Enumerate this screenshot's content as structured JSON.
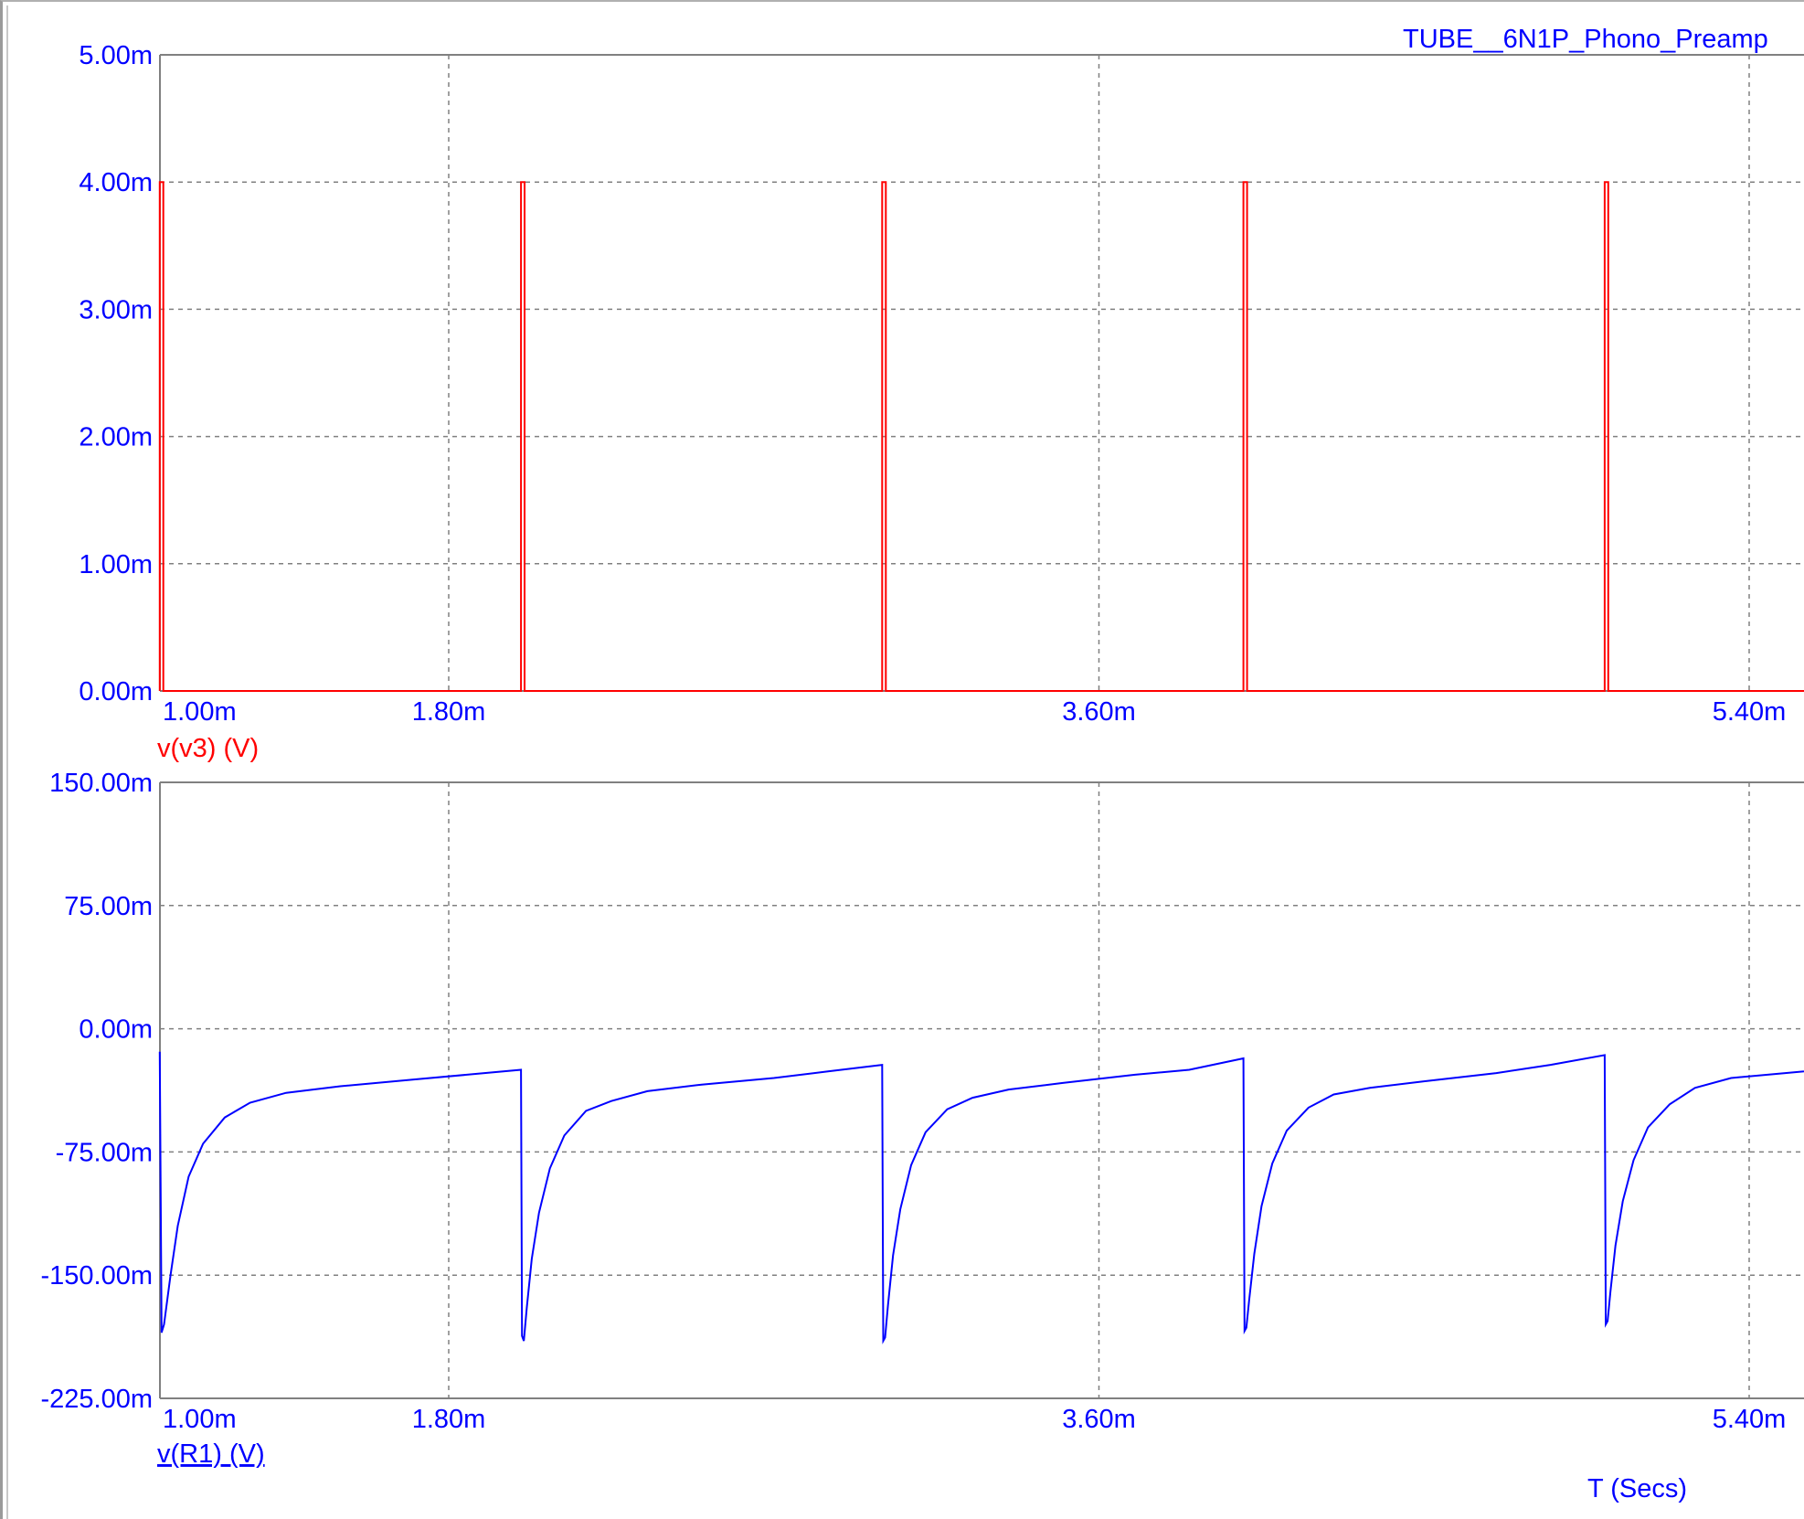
{
  "title": "TUBE__6N1P_Phono_Preamp",
  "x_axis_label": "T (Secs)",
  "colors": {
    "top_trace": "#ff0000",
    "bottom_trace": "#0000ff",
    "text_blue": "#0000ff",
    "grid": "#808080",
    "axis": "#808080"
  },
  "chart_data": [
    {
      "type": "line",
      "name": "top-plot",
      "title": "TUBE__6N1P_Phono_Preamp",
      "trace_label": "v(v3) (V)",
      "xlim": [
        1.0,
        6.0
      ],
      "ylim": [
        0.0,
        5.0
      ],
      "x_ticks": [
        {
          "v": 1.0,
          "label": "1.00m"
        },
        {
          "v": 1.8,
          "label": "1.80m"
        },
        {
          "v": 3.6,
          "label": "3.60m"
        },
        {
          "v": 5.4,
          "label": "5.40m"
        }
      ],
      "y_ticks": [
        {
          "v": 0,
          "label": "0.00m"
        },
        {
          "v": 1,
          "label": "1.00m"
        },
        {
          "v": 2,
          "label": "2.00m"
        },
        {
          "v": 3,
          "label": "3.00m"
        },
        {
          "v": 4,
          "label": "4.00m"
        },
        {
          "v": 5,
          "label": "5.00m"
        }
      ],
      "x_grid": [
        1.8,
        3.6,
        5.4
      ],
      "y_grid": [
        1,
        2,
        3,
        4
      ],
      "series": [
        {
          "x": [
            1.0,
            1.0,
            1.01,
            1.01,
            2.0,
            2.0,
            2.01,
            2.01,
            3.0,
            3.0,
            3.01,
            3.01,
            4.0,
            4.0,
            4.01,
            4.01,
            5.0,
            5.0,
            5.01,
            5.01,
            6.0
          ],
          "y": [
            0,
            4,
            4,
            0,
            0,
            4,
            4,
            0,
            0,
            4,
            4,
            0,
            0,
            4,
            4,
            0,
            0,
            4,
            4,
            0,
            0
          ]
        }
      ]
    },
    {
      "type": "line",
      "name": "bottom-plot",
      "trace_label": "v(R1) (V)",
      "xlim": [
        1.0,
        6.0
      ],
      "ylim": [
        -225,
        150
      ],
      "x_ticks": [
        {
          "v": 1.0,
          "label": "1.00m"
        },
        {
          "v": 1.8,
          "label": "1.80m"
        },
        {
          "v": 3.6,
          "label": "3.60m"
        },
        {
          "v": 5.4,
          "label": "5.40m"
        }
      ],
      "y_ticks": [
        {
          "v": 150,
          "label": "150.00m"
        },
        {
          "v": 75,
          "label": "75.00m"
        },
        {
          "v": 0,
          "label": "0.00m"
        },
        {
          "v": -75,
          "label": "-75.00m"
        },
        {
          "v": -150,
          "label": "-150.00m"
        },
        {
          "v": -225,
          "label": "-225.00m"
        }
      ],
      "x_grid": [
        1.8,
        3.6,
        5.4
      ],
      "y_grid": [
        75,
        0,
        -75,
        -150
      ],
      "series": [
        {
          "x": [
            1.0,
            1.005,
            1.012,
            1.03,
            1.05,
            1.08,
            1.12,
            1.18,
            1.25,
            1.35,
            1.5,
            1.7,
            1.85,
            2.0,
            2.003,
            2.008,
            2.016,
            2.03,
            2.05,
            2.08,
            2.12,
            2.18,
            2.25,
            2.35,
            2.5,
            2.7,
            2.85,
            3.0,
            3.003,
            3.008,
            3.016,
            3.03,
            3.05,
            3.08,
            3.12,
            3.18,
            3.25,
            3.35,
            3.5,
            3.7,
            3.85,
            4.0,
            4.003,
            4.008,
            4.016,
            4.03,
            4.05,
            4.08,
            4.12,
            4.18,
            4.25,
            4.35,
            4.5,
            4.7,
            4.85,
            5.0,
            5.003,
            5.008,
            5.016,
            5.03,
            5.05,
            5.08,
            5.12,
            5.18,
            5.25,
            5.35,
            5.5,
            5.7,
            5.85,
            6.0
          ],
          "y": [
            -14,
            -185,
            -180,
            -150,
            -120,
            -90,
            -70,
            -54,
            -45,
            -39,
            -35,
            -31,
            -28,
            -25,
            -187,
            -190,
            -170,
            -140,
            -112,
            -85,
            -65,
            -50,
            -44,
            -38,
            -34,
            -30,
            -26,
            -22,
            -190,
            -188,
            -168,
            -138,
            -110,
            -83,
            -63,
            -49,
            -42,
            -37,
            -33,
            -28,
            -25,
            -18,
            -184,
            -182,
            -165,
            -137,
            -108,
            -82,
            -62,
            -48,
            -40,
            -36,
            -32,
            -27,
            -22,
            -16,
            -180,
            -178,
            -160,
            -132,
            -105,
            -80,
            -60,
            -46,
            -36,
            -30,
            -27,
            -23,
            -20,
            -16
          ]
        }
      ]
    }
  ]
}
